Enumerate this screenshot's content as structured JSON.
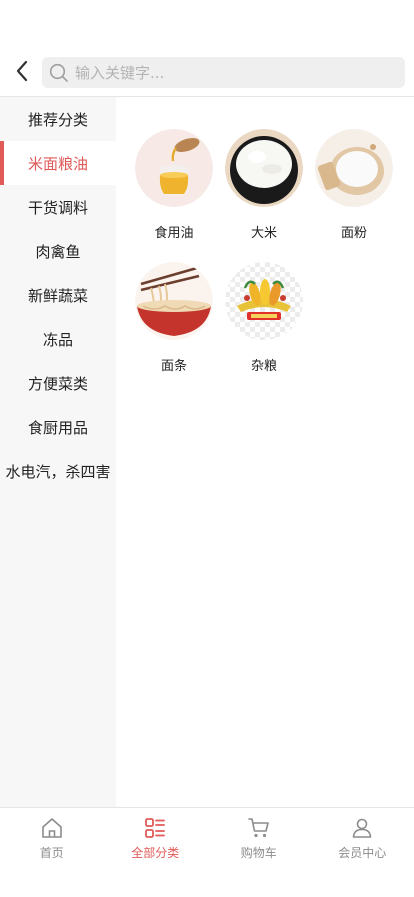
{
  "header": {
    "back_icon": "chevron-left-icon",
    "search_icon": "search-icon",
    "search_placeholder": "输入关键字...",
    "search_value": ""
  },
  "sidebar": {
    "active_index": 1,
    "items": [
      {
        "label": "推荐分类"
      },
      {
        "label": "米面粮油"
      },
      {
        "label": "干货调料"
      },
      {
        "label": "肉禽鱼"
      },
      {
        "label": "新鲜蔬菜"
      },
      {
        "label": "冻品"
      },
      {
        "label": "方便菜类"
      },
      {
        "label": "食厨用品"
      },
      {
        "label": "水电汽，杀四害"
      }
    ]
  },
  "categories": [
    {
      "label": "食用油",
      "icon": "cooking-oil-image"
    },
    {
      "label": "大米",
      "icon": "rice-bowl-image"
    },
    {
      "label": "面粉",
      "icon": "flour-bowl-image"
    },
    {
      "label": "面条",
      "icon": "noodles-bowl-image"
    },
    {
      "label": "杂粮",
      "icon": "mixed-grains-image"
    }
  ],
  "tabbar": {
    "active_index": 1,
    "items": [
      {
        "label": "首页",
        "icon": "home-icon"
      },
      {
        "label": "全部分类",
        "icon": "category-list-icon"
      },
      {
        "label": "购物车",
        "icon": "cart-icon"
      },
      {
        "label": "会员中心",
        "icon": "user-icon"
      }
    ]
  },
  "colors": {
    "accent": "#e05a58",
    "sidebar_bg": "#f7f7f7",
    "search_bg": "#efefef",
    "inactive_text": "#8c8c8c"
  }
}
